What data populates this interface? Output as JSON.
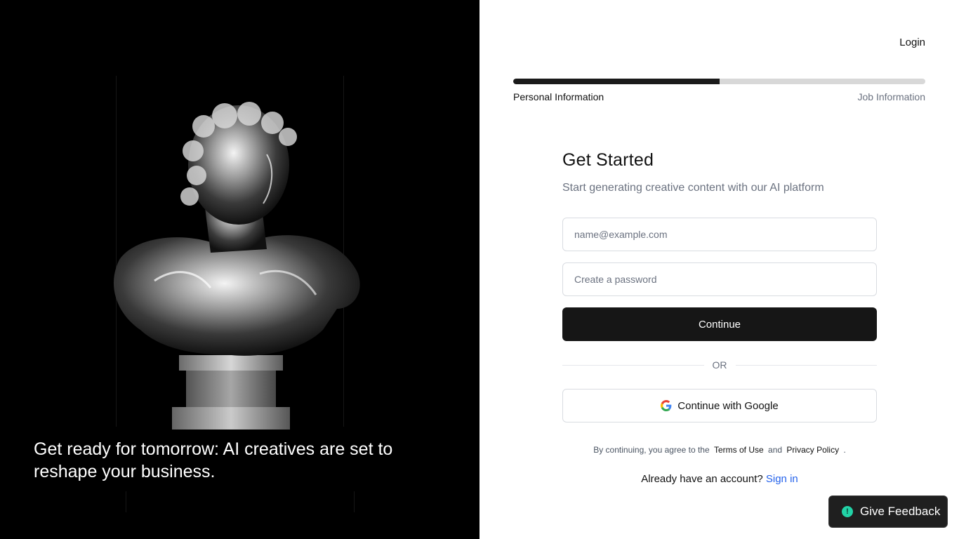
{
  "hero": {
    "tagline": "Get ready for tomorrow: AI creatives are set to reshape your business."
  },
  "header": {
    "login_label": "Login"
  },
  "progress": {
    "fraction": 0.5,
    "step1_label": "Personal Information",
    "step2_label": "Job Information"
  },
  "form": {
    "title": "Get Started",
    "subtitle": "Start generating creative content with our AI platform",
    "email_placeholder": "name@example.com",
    "password_placeholder": "Create a password",
    "continue_label": "Continue",
    "or_label": "OR",
    "google_label": "Continue with Google",
    "legal_prefix": "By continuing, you agree to the",
    "terms_label": "Terms of Use",
    "and_label": "and",
    "privacy_label": "Privacy Policy",
    "legal_suffix": ".",
    "account_prompt": "Already have an account?",
    "signin_label": "Sign in"
  },
  "feedback": {
    "label": "Give Feedback",
    "icon": "info-icon"
  },
  "colors": {
    "primary_button": "#161616",
    "link": "#2563eb",
    "feedback_icon": "#22d3a7"
  }
}
